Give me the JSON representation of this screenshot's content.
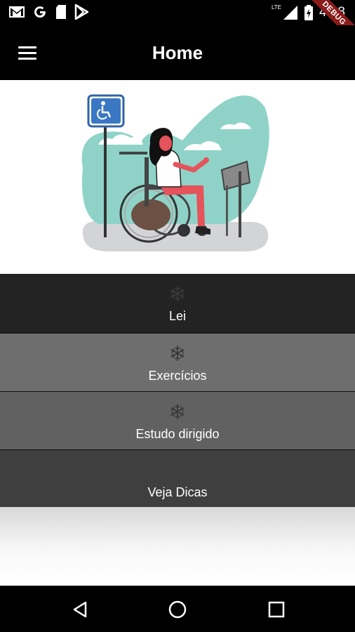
{
  "status_bar": {
    "time": "4:08",
    "network": "LTE",
    "icons": [
      "gmail-icon",
      "google-icon",
      "sd-card-icon",
      "play-store-icon",
      "signal-icon",
      "battery-charging-icon"
    ]
  },
  "debug_banner": "DEBUG",
  "app_bar": {
    "title": "Home",
    "menu_icon": "hamburger-menu-icon"
  },
  "hero": {
    "illustration": "wheelchair-user-illustration",
    "sign_icon": "accessibility-sign-icon"
  },
  "menu": {
    "items": [
      {
        "label": "Lei",
        "icon": "snowflake-icon",
        "bg": "#232323"
      },
      {
        "label": "Exercícios",
        "icon": "snowflake-icon",
        "bg": "#6e6e6e"
      },
      {
        "label": "Estudo dirigido",
        "icon": "snowflake-icon",
        "bg": "#616161"
      },
      {
        "label": "Veja Dicas",
        "icon": "",
        "bg": "#3f3f3f"
      }
    ]
  },
  "nav_bar": {
    "buttons": [
      "back-icon",
      "home-icon",
      "recents-icon"
    ]
  },
  "colors": {
    "app_bar": "#000000",
    "accent_red": "#e5535b",
    "accent_teal": "#8fd3c8",
    "sign_blue": "#3b78c4"
  }
}
